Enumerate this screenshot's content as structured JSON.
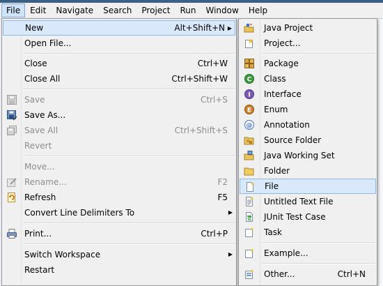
{
  "menubar": {
    "items": [
      "File",
      "Edit",
      "Navigate",
      "Search",
      "Project",
      "Run",
      "Window",
      "Help"
    ]
  },
  "file_menu": {
    "new": {
      "label": "New",
      "accel": "Alt+Shift+N"
    },
    "open_file": {
      "label": "Open File..."
    },
    "close": {
      "label": "Close",
      "accel": "Ctrl+W"
    },
    "close_all": {
      "label": "Close All",
      "accel": "Ctrl+Shift+W"
    },
    "save": {
      "label": "Save",
      "accel": "Ctrl+S"
    },
    "save_as": {
      "label": "Save As..."
    },
    "save_all": {
      "label": "Save All",
      "accel": "Ctrl+Shift+S"
    },
    "revert": {
      "label": "Revert"
    },
    "move": {
      "label": "Move..."
    },
    "rename": {
      "label": "Rename...",
      "accel": "F2"
    },
    "refresh": {
      "label": "Refresh",
      "accel": "F5"
    },
    "convert_line_delimiters": {
      "label": "Convert Line Delimiters To"
    },
    "print": {
      "label": "Print...",
      "accel": "Ctrl+P"
    },
    "switch_workspace": {
      "label": "Switch Workspace"
    },
    "restart": {
      "label": "Restart"
    }
  },
  "new_submenu": {
    "java_project": {
      "label": "Java Project"
    },
    "project": {
      "label": "Project..."
    },
    "package": {
      "label": "Package"
    },
    "class": {
      "label": "Class"
    },
    "interface": {
      "label": "Interface"
    },
    "enum": {
      "label": "Enum"
    },
    "annotation": {
      "label": "Annotation"
    },
    "source_folder": {
      "label": "Source Folder"
    },
    "java_working_set": {
      "label": "Java Working Set"
    },
    "folder": {
      "label": "Folder"
    },
    "file": {
      "label": "File"
    },
    "untitled_text_file": {
      "label": "Untitled Text File"
    },
    "junit_test_case": {
      "label": "JUnit Test Case"
    },
    "task": {
      "label": "Task"
    },
    "example": {
      "label": "Example..."
    },
    "other": {
      "label": "Other...",
      "accel": "Ctrl+N"
    }
  }
}
